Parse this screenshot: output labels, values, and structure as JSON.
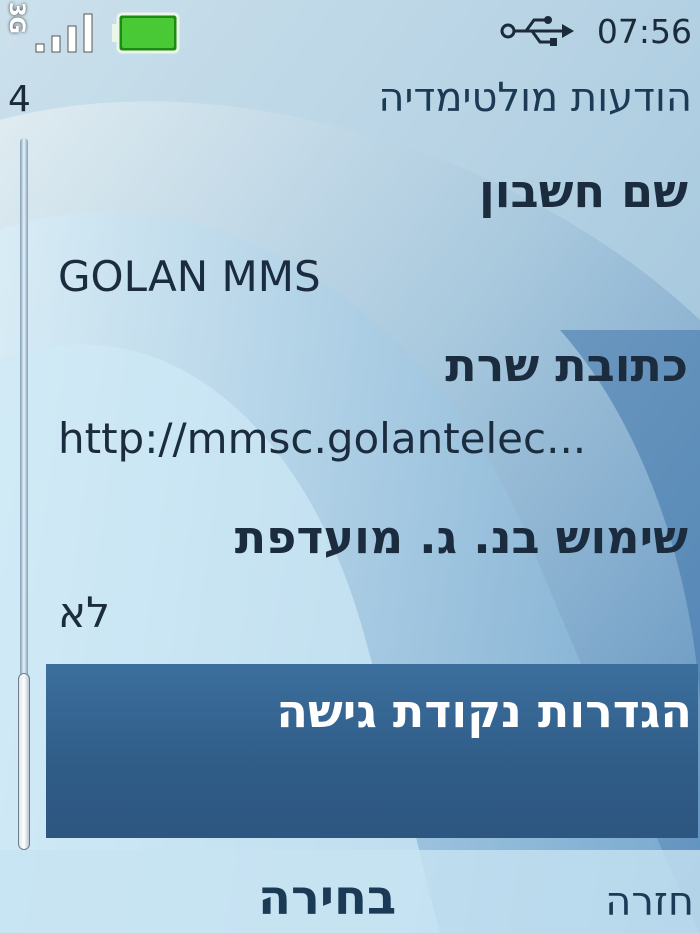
{
  "status_bar": {
    "network_type": "3G",
    "signal_bars": 4,
    "battery_level": 1.0,
    "usb_icon": "usb-icon",
    "time": "07:56"
  },
  "header": {
    "page_number": "4",
    "title": "הודעות מולטימדיה"
  },
  "settings": [
    {
      "label": "שם חשבון",
      "value": "GOLAN MMS"
    },
    {
      "label": "כתובת שרת",
      "value": "http://mmsc.golantelec..."
    },
    {
      "label": "שימוש בנ. ג. מועדפת",
      "value": "לא"
    }
  ],
  "selected_item": {
    "label": "הגדרות נקודת גישה"
  },
  "scroll": {
    "position_fraction": 1.0
  },
  "softkeys": {
    "select": "בחירה",
    "back": "חזרה"
  },
  "colors": {
    "text": "#1b2c3e",
    "highlight": "#3c6f9d",
    "background": "#bcd9ea"
  }
}
